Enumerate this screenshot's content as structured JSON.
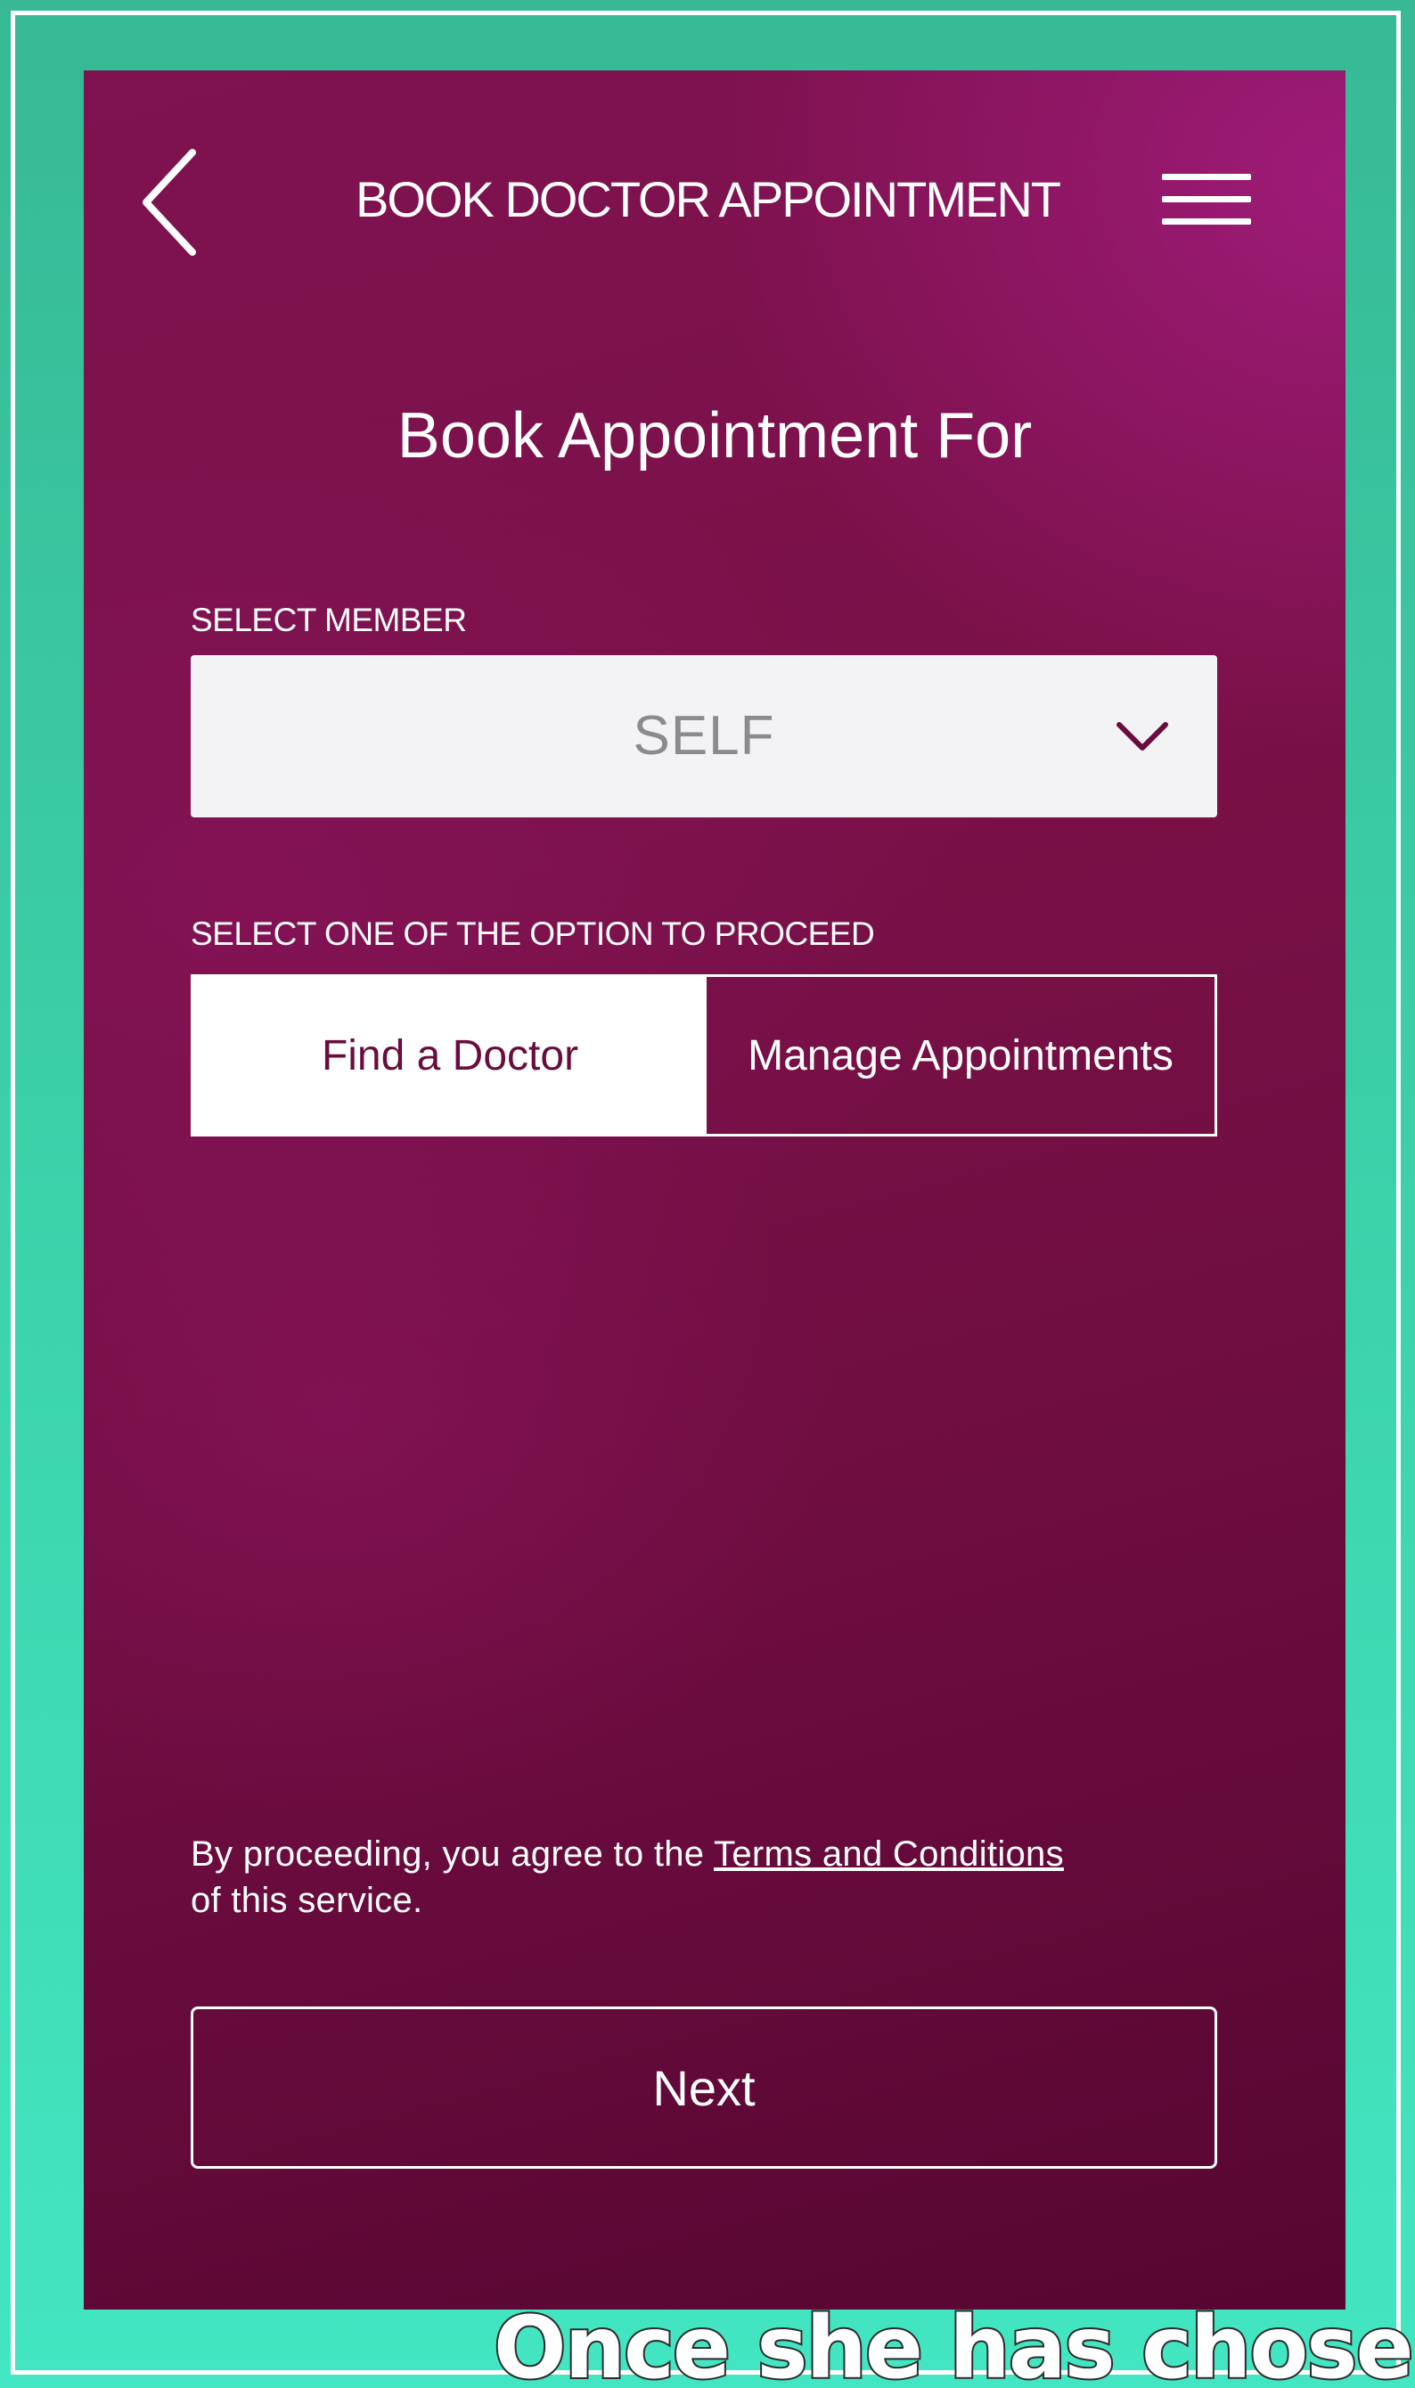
{
  "header": {
    "title_light": "BOOK DOCTOR",
    "title_bold": "APPOINTMENT",
    "back_icon": "chevron-left-icon",
    "menu_icon": "hamburger-menu-icon"
  },
  "heading": {
    "light": "Book",
    "strong": "Appointment For"
  },
  "member_select": {
    "label": "SELECT MEMBER",
    "value": "SELF",
    "icon": "chevron-down-icon"
  },
  "options": {
    "label": "SELECT ONE OF THE OPTION TO PROCEED",
    "items": [
      {
        "label": "Find a Doctor",
        "selected": true
      },
      {
        "label": "Manage Appointments",
        "selected": false
      }
    ]
  },
  "terms": {
    "prefix": "By proceeding, you agree to the ",
    "link": "Terms and Conditions",
    "suffix": "of this service."
  },
  "next_button": {
    "label": "Next"
  },
  "caption": {
    "text": "Once she has chosen"
  },
  "colors": {
    "background_teal": "#3cd4ac",
    "app_magenta": "#7a1148",
    "select_bg": "#f3f3f6",
    "active_option_text": "#6b0d3c"
  }
}
